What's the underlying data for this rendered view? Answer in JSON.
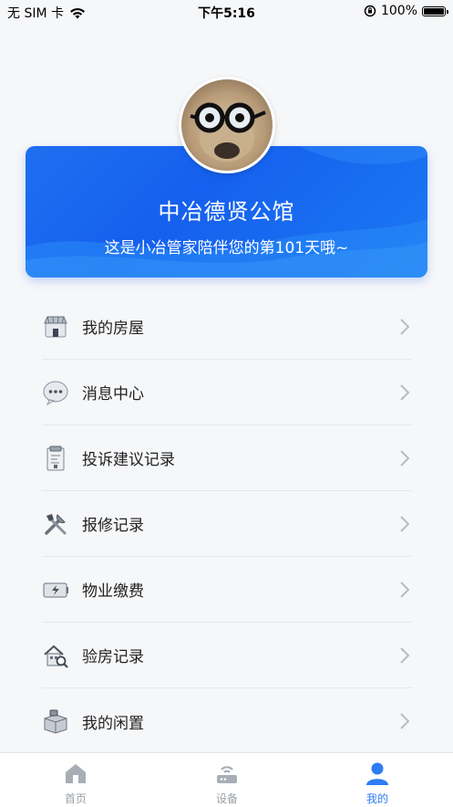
{
  "status_bar": {
    "carrier": "无 SIM 卡",
    "time": "下午5:16",
    "battery_percent": "100%"
  },
  "profile": {
    "community_name": "中冶德贤公馆",
    "greeting": "这是小冶管家陪伴您的第101天哦~"
  },
  "menu": {
    "items": [
      {
        "label": "我的房屋",
        "icon": "shop-house-icon"
      },
      {
        "label": "消息中心",
        "icon": "chat-bubble-icon"
      },
      {
        "label": "投诉建议记录",
        "icon": "clipboard-icon"
      },
      {
        "label": "报修记录",
        "icon": "tools-icon"
      },
      {
        "label": "物业缴费",
        "icon": "battery-payment-icon"
      },
      {
        "label": "验房记录",
        "icon": "house-inspect-icon"
      },
      {
        "label": "我的闲置",
        "icon": "box-tag-icon"
      }
    ]
  },
  "tabbar": {
    "tabs": [
      {
        "label": "首页",
        "icon": "home-icon"
      },
      {
        "label": "设备",
        "icon": "router-icon"
      },
      {
        "label": "我的",
        "icon": "person-icon"
      }
    ],
    "active_index": 2,
    "active_color": "#2f7cf6",
    "inactive_color": "#9aa0a8"
  },
  "colors": {
    "card_blue": "#1f6ff0",
    "background": "#f6f7f9"
  }
}
